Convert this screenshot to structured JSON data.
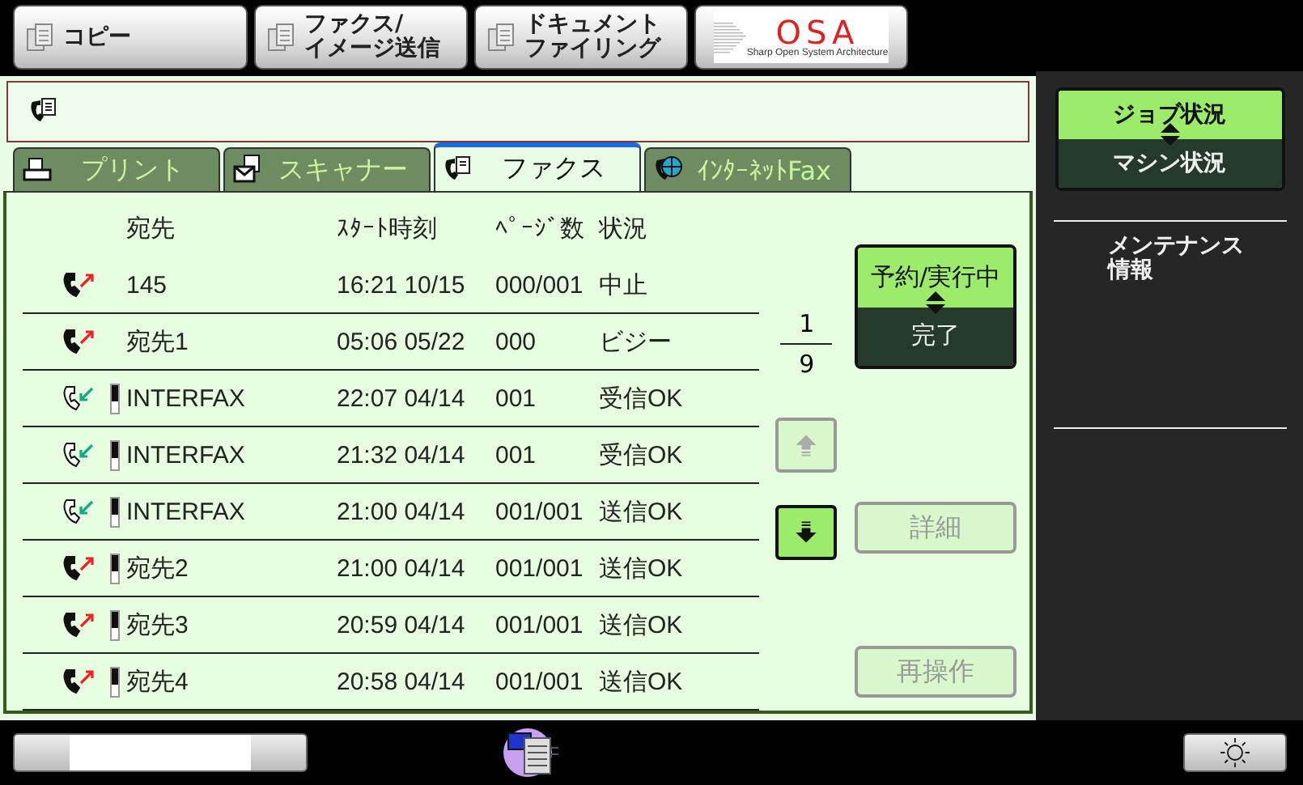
{
  "top_buttons": [
    {
      "lines": [
        "コピー"
      ],
      "kind": "mode"
    },
    {
      "lines": [
        "ファクス/",
        "イメージ送信"
      ],
      "kind": "mode"
    },
    {
      "lines": [
        "ドキュメント",
        "ファイリング"
      ],
      "kind": "mode"
    },
    {
      "lines": [
        "OSA",
        "Sharp Open System Architecture"
      ],
      "kind": "logo"
    }
  ],
  "tabs": [
    {
      "label": "プリント",
      "selected": false
    },
    {
      "label": "スキャナー",
      "selected": false
    },
    {
      "label": "ファクス",
      "selected": true
    },
    {
      "label": "ｲﾝﾀｰﾈｯﾄFax",
      "selected": false
    }
  ],
  "table": {
    "columns": [
      "宛先",
      "ｽﾀｰﾄ時刻",
      "ﾍﾟｰｼﾞ数",
      "状況"
    ],
    "rows": [
      {
        "kind": "send",
        "marker": false,
        "name": "145",
        "time": "16:21 10/15",
        "pages": "000/001",
        "status": "中止"
      },
      {
        "kind": "send",
        "marker": false,
        "name": "宛先1",
        "time": "05:06 05/22",
        "pages": "000",
        "status": "ビジー"
      },
      {
        "kind": "receive",
        "marker": true,
        "name": "INTERFAX",
        "time": "22:07 04/14",
        "pages": "001",
        "status": "受信OK"
      },
      {
        "kind": "receive",
        "marker": true,
        "name": "INTERFAX",
        "time": "21:32 04/14",
        "pages": "001",
        "status": "受信OK"
      },
      {
        "kind": "receive",
        "marker": true,
        "name": "INTERFAX",
        "time": "21:00 04/14",
        "pages": "001/001",
        "status": "送信OK"
      },
      {
        "kind": "send",
        "marker": true,
        "name": "宛先2",
        "time": "21:00 04/14",
        "pages": "001/001",
        "status": "送信OK"
      },
      {
        "kind": "send",
        "marker": true,
        "name": "宛先3",
        "time": "20:59 04/14",
        "pages": "001/001",
        "status": "送信OK"
      },
      {
        "kind": "send",
        "marker": true,
        "name": "宛先4",
        "time": "20:58 04/14",
        "pages": "001/001",
        "status": "送信OK"
      }
    ]
  },
  "pager": {
    "current": "1",
    "total": "9",
    "up_disabled": true,
    "down_disabled": false
  },
  "list_toggle": [
    {
      "label": "予約/実行中",
      "selected": true
    },
    {
      "label": "完了",
      "selected": false
    }
  ],
  "actions": [
    {
      "label": "詳細",
      "disabled": true
    },
    {
      "label": "再操作",
      "disabled": true
    }
  ],
  "status_toggle": [
    {
      "label": "ジョブ状況",
      "selected": true
    },
    {
      "label": "マシン状況",
      "selected": false
    }
  ],
  "side_items": [
    [
      "メンテナンス",
      "情報"
    ]
  ]
}
